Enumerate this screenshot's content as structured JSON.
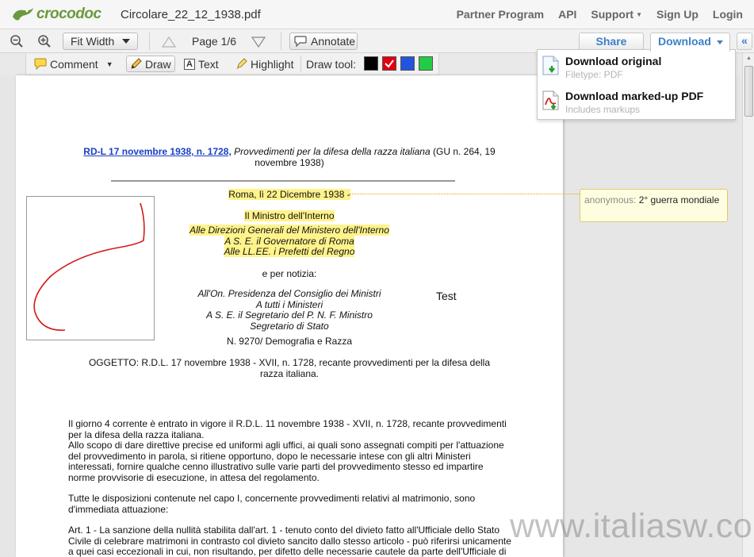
{
  "app": {
    "logo_text": "crocodoc",
    "document_title": "Circolare_22_12_1938.pdf"
  },
  "topnav": {
    "partner": "Partner Program",
    "api": "API",
    "support": "Support",
    "signup": "Sign Up",
    "login": "Login"
  },
  "toolbar": {
    "fit_width": "Fit Width",
    "page_indicator": "Page 1/6",
    "annotate": "Annotate",
    "share": "Share",
    "download": "Download",
    "collapse": "«"
  },
  "annobar": {
    "comment": "Comment",
    "draw": "Draw",
    "text": "Text",
    "highlight": "Highlight",
    "draw_tool_label": "Draw tool:",
    "colors": [
      "#000000",
      "#e00010",
      "#2255dd",
      "#22cc44"
    ],
    "selected_color": "#e00010"
  },
  "download_menu": {
    "original_title": "Download original",
    "original_sub": "Filetype: PDF",
    "markup_title": "Download marked-up PDF",
    "markup_sub": "Includes markups"
  },
  "comment": {
    "author": "anonymous:",
    "text": "2° guerra mondiale"
  },
  "document": {
    "link": "RD-L 17 novembre 1938, n. 1728,",
    "title_rest": "Provvedimenti per la difesa della razza italiana",
    "gu": "(GU n. 264, 19 novembre 1938)",
    "date": "Roma, lì 22 Dicembre 1938 -",
    "minister": "Il Ministro dell'Interno",
    "recipients": [
      "Alle Direzioni Generali del Ministero dell'Interno",
      "A S. E. il Governatore di Roma",
      "Alle LL.EE. i Prefetti del Regno"
    ],
    "per_notizia": "e per notizia:",
    "notice": [
      "All'On. Presidenza del Consiglio dei Ministri",
      "A tutti i Ministeri",
      "A S. E. il Segretario del P. N. F. Ministro",
      "Segretario di Stato"
    ],
    "test_label": "Test",
    "protocol": "N. 9270/ Demografia e Razza",
    "subject": "OGGETTO: R.D.L. 17 novembre 1938 - XVII, n. 1728, recante provvedimenti per la difesa della razza italiana.",
    "paragraphs": [
      "Il giorno 4 corrente è entrato in vigore il R.D.L. 11 novembre 1938 - XVII, n. 1728, recante provvedimenti per la difesa della razza italiana.",
      "Allo scopo di dare direttive precise ed uniformi agli uffici, ai quali sono assegnati compiti per l'attuazione del provvedimento in parola, si ritiene opportuno, dopo le necessarie intese con gli altri Ministeri interessati, fornire qualche cenno illustrativo sulle varie parti del provvedimento stesso ed impartire norme provvisorie di esecuzione, in attesa del regolamento.",
      "Tutte le disposizioni contenute nel capo I, concernente provvedimenti relativi al matrimonio, sono d'immediata attuazione:",
      "Art. 1 - La sanzione della nullità stabilita dall'art. 1 - tenuto conto del divieto fatto all'Ufficiale dello Stato Civile di celebrare matrimoni in contrasto col divieto sancito dallo stesso articolo - può riferirsi unicamente a quei casi eccezionali in cui, non risultando, per difetto delle necessarie cautele da parte dell'Ufficiale di Stato"
    ]
  },
  "watermark": "www.italiasw.com"
}
